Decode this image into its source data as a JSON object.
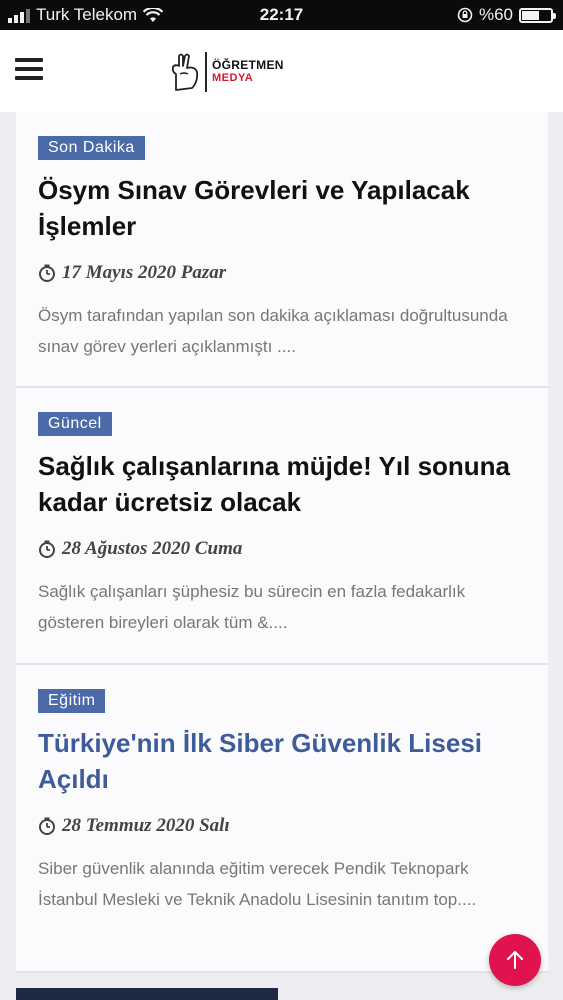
{
  "status_bar": {
    "carrier": "Turk Telekom",
    "time": "22:17",
    "battery": "%60",
    "battery_level": 0.6
  },
  "header": {
    "logo_line1": "ÖĞRETMEN",
    "logo_line2": "MEDYA",
    "menu_icon": "hamburger-icon"
  },
  "articles": [
    {
      "category": "Son Dakika",
      "title": "Ösym Sınav Görevleri ve Yapılacak İşlemler",
      "date": "17 Mayıs 2020 Pazar",
      "excerpt": "Ösym tarafından yapılan son dakika açıklaması doğrultusunda sınav görev yerleri açıklanmıştı ...."
    },
    {
      "category": "Güncel",
      "title": "Sağlık çalışanlarına müjde! Yıl sonuna kadar ücretsiz olacak",
      "date": "28 Ağustos 2020 Cuma",
      "excerpt": "Sağlık çalışanları şüphesiz bu sürecin en fazla fedakarlık gösteren bireyleri olarak tüm &...."
    },
    {
      "category": "Eğitim",
      "title": "Türkiye'nin İlk Siber Güvenlik Lisesi Açıldı",
      "date": "28 Temmuz 2020 Salı",
      "excerpt": "Siber güvenlik alanında eğitim verecek Pendik Teknopark İstanbul Mesleki ve Teknik Anadolu Lisesinin tanıtım top...."
    }
  ],
  "colors": {
    "badge": "#4a6aa8",
    "title_link": "#3e5c99",
    "fab": "#e0134f"
  },
  "fab_icon": "arrow-up-icon"
}
